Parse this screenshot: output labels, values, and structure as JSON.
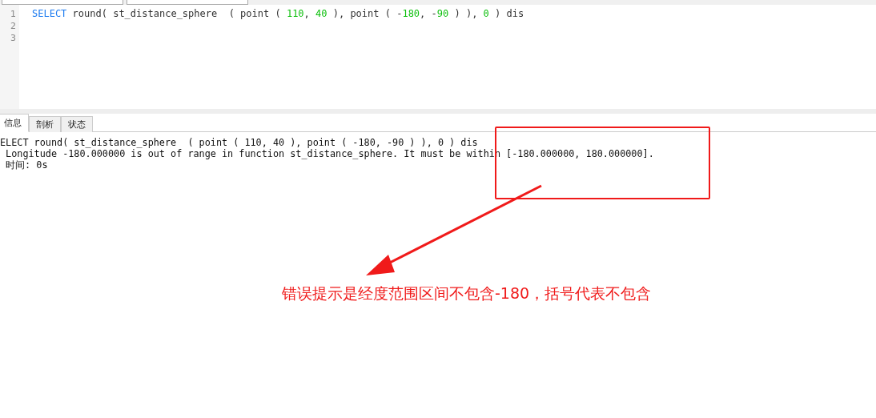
{
  "editor": {
    "lines": [
      {
        "number": "1",
        "tokens": [
          {
            "text": "SELECT",
            "kind": "keyword"
          },
          {
            "text": " round( st_distance_sphere  ( point ( ",
            "kind": "plain"
          },
          {
            "text": "110",
            "kind": "number"
          },
          {
            "text": ", ",
            "kind": "plain"
          },
          {
            "text": "40",
            "kind": "number"
          },
          {
            "text": " ), point ( -",
            "kind": "plain"
          },
          {
            "text": "180",
            "kind": "number"
          },
          {
            "text": ", -",
            "kind": "plain"
          },
          {
            "text": "90",
            "kind": "number"
          },
          {
            "text": " ) ), ",
            "kind": "plain"
          },
          {
            "text": "0",
            "kind": "number"
          },
          {
            "text": " ) dis",
            "kind": "plain"
          }
        ]
      },
      {
        "number": "2"
      },
      {
        "number": "3"
      }
    ]
  },
  "result_tabs": [
    {
      "label": "信息",
      "selected": true
    },
    {
      "label": "剖析",
      "selected": false
    },
    {
      "label": "状态",
      "selected": false
    }
  ],
  "messages": [
    "ELECT round( st_distance_sphere  ( point ( 110, 40 ), point ( -180, -90 ) ), 0 ) dis",
    " Longitude -180.000000 is out of range in function st_distance_sphere. It must be within [-180.000000, 180.000000].",
    " 时间: 0s"
  ],
  "annotation": {
    "caption": "错误提示是经度范围区间不包含-180，括号代表不包含"
  }
}
